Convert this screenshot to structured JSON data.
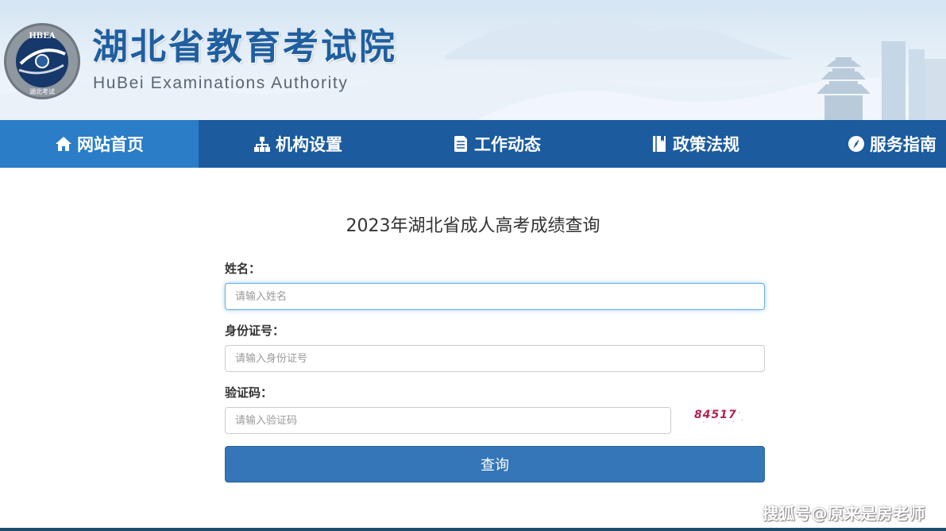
{
  "header": {
    "title": "湖北省教育考试院",
    "subtitle": "HuBei Examinations Authority",
    "logo_text_top": "HBEA",
    "logo_text_bottom": "湖北考试",
    "colors": {
      "title": "#1f5fa0",
      "banner": "#d5e5f3"
    }
  },
  "nav": {
    "items": [
      {
        "label": "网站首页",
        "icon": "home-icon",
        "active": true
      },
      {
        "label": "机构设置",
        "icon": "org-chart-icon"
      },
      {
        "label": "工作动态",
        "icon": "document-icon"
      },
      {
        "label": "政策法规",
        "icon": "book-icon"
      },
      {
        "label": "服务指南",
        "icon": "compass-icon"
      }
    ],
    "colors": {
      "background": "#1b5b9e",
      "active": "#2a7dc6"
    }
  },
  "form": {
    "title": "2023年湖北省成人高考成绩查询",
    "name_label": "姓名：",
    "name_placeholder": "请输入姓名",
    "id_label": "身份证号：",
    "id_placeholder": "请输入身份证号",
    "captcha_label": "验证码：",
    "captcha_placeholder": "请输入验证码",
    "captcha_value": "84517",
    "submit_label": "查询",
    "colors": {
      "button": "#3476b7",
      "captcha": "#b0234f"
    }
  },
  "watermark": "搜狐号@原来是房老师"
}
